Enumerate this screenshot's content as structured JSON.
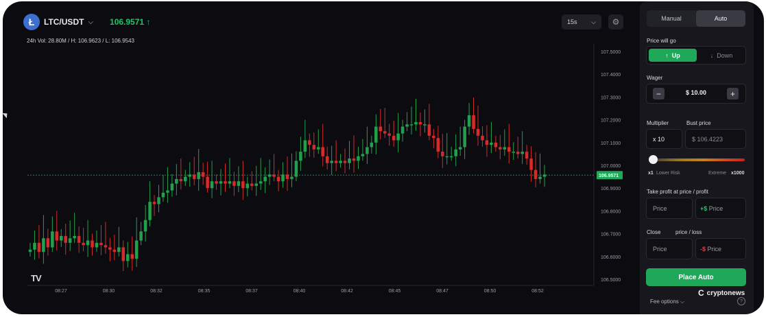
{
  "header": {
    "coin_glyph": "Ł",
    "pair": "LTC/USDT",
    "pair_chevron": "⌵",
    "price": "106.9571 ↑",
    "stats": "24h Vol: 28.80M / H: 106.9623 / L: 106.9543"
  },
  "toolbar": {
    "timeframe": "15s",
    "timeframe_chevron": "⌵",
    "settings_glyph": "⚙"
  },
  "chart_data": {
    "type": "candlestick",
    "ylim": [
      106.5,
      107.5
    ],
    "y_ticks": [
      "107.5000",
      "107.4000",
      "107.3000",
      "107.2000",
      "107.1000",
      "107.0000",
      "106.9000",
      "106.8000",
      "106.7000",
      "106.6000",
      "106.5000"
    ],
    "x_ticks": [
      "08:27",
      "08:30",
      "08:32",
      "08:35",
      "08:37",
      "08:40",
      "08:42",
      "08:45",
      "08:47",
      "08:50",
      "08:52"
    ],
    "current_price": "106.9571",
    "colors": {
      "up": "#23a04e",
      "down": "#d42b2b",
      "price_line": "#1c8a48",
      "price_label_bg": "#1fa85a"
    },
    "closes": [
      106.63,
      106.66,
      106.62,
      106.68,
      106.64,
      106.71,
      106.67,
      106.69,
      106.66,
      106.68,
      106.69,
      106.66,
      106.65,
      106.67,
      106.64,
      106.66,
      106.65,
      106.64,
      106.63,
      106.62,
      106.64,
      106.58,
      106.61,
      106.59,
      106.67,
      106.71,
      106.76,
      106.84,
      106.83,
      106.86,
      106.88,
      106.89,
      106.92,
      106.94,
      106.93,
      106.95,
      106.96,
      106.94,
      106.97,
      106.95,
      106.9,
      106.93,
      106.92,
      106.93,
      106.92,
      106.93,
      106.91,
      106.93,
      106.9,
      106.92,
      106.91,
      106.92,
      106.93,
      106.95,
      106.96,
      106.95,
      106.93,
      106.96,
      106.94,
      106.95,
      107.02,
      107.06,
      107.11,
      107.09,
      107.07,
      107.08,
      107.04,
      107.01,
      107.02,
      107.01,
      107.02,
      107.01,
      107.03,
      107.02,
      107.04,
      107.05,
      107.08,
      107.1,
      107.17,
      107.15,
      107.14,
      107.13,
      107.11,
      107.14,
      107.17,
      107.18,
      107.18,
      107.19,
      107.18,
      107.18,
      107.13,
      107.12,
      107.06,
      107.04,
      107.04,
      107.04,
      107.07,
      107.08,
      107.17,
      107.22,
      107.16,
      107.13,
      107.11,
      107.09,
      107.1,
      107.08,
      107.07,
      107.08,
      107.06,
      107.06,
      107.05,
      107.06,
      107.03,
      106.98,
      106.94,
      106.95,
      106.96
    ]
  },
  "panel": {
    "tabs": [
      "Manual",
      "Auto"
    ],
    "active_tab": "Auto",
    "price_will_go_label": "Price will go",
    "up_label": "Up",
    "up_glyph": "↑",
    "down_label": "Down",
    "down_glyph": "↓",
    "wager_label": "Wager",
    "wager_minus": "−",
    "wager_value": "$ 10.00",
    "wager_plus": "+",
    "multiplier_label": "Multiplier",
    "bust_label": "Bust price",
    "multiplier_value": "x 10",
    "bust_value": "$ 106.4223",
    "risk_min_x": "x1",
    "risk_min": "Lower Risk",
    "risk_max": "Extreme",
    "risk_max_x": "x1000",
    "risk_level": 0.01,
    "take_profit_label": "Take profit at price / profit",
    "tp_price_placeholder": "Price",
    "tp_profit_prefix": "+$",
    "tp_profit_placeholder": "Price",
    "close_label": "Close",
    "close_label_2": "price / loss",
    "cl_price_placeholder": "Price",
    "cl_loss_prefix": "-$",
    "cl_loss_placeholder": "Price",
    "place_label": "Place Auto",
    "fee_label": "Fee options",
    "fee_chevron": "⌵"
  },
  "watermark": {
    "glyph": "C",
    "label": "cryptonews",
    "help_glyph": "?"
  },
  "chart_logo": "TV"
}
